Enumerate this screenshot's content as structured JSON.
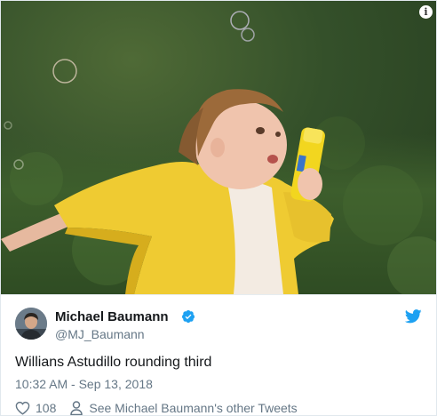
{
  "colors": {
    "twitter_blue": "#1da1f2",
    "text_primary": "#14171a",
    "text_secondary": "#657786",
    "raincoat_yellow": "#f0cc2e"
  },
  "media": {
    "info_icon_glyph": "i",
    "info_icon_name": "info-icon"
  },
  "tweet": {
    "author": {
      "name": "Michael Baumann",
      "handle": "@MJ_Baumann",
      "verified": true
    },
    "text": "Willians Astudillo rounding third",
    "timestamp": "10:32 AM - Sep 13, 2018",
    "likes": "108",
    "see_others": "See Michael Baumann's other Tweets"
  },
  "icons": [
    "info-icon",
    "verified-badge-icon",
    "twitter-bird-icon",
    "heart-icon",
    "person-icon"
  ]
}
